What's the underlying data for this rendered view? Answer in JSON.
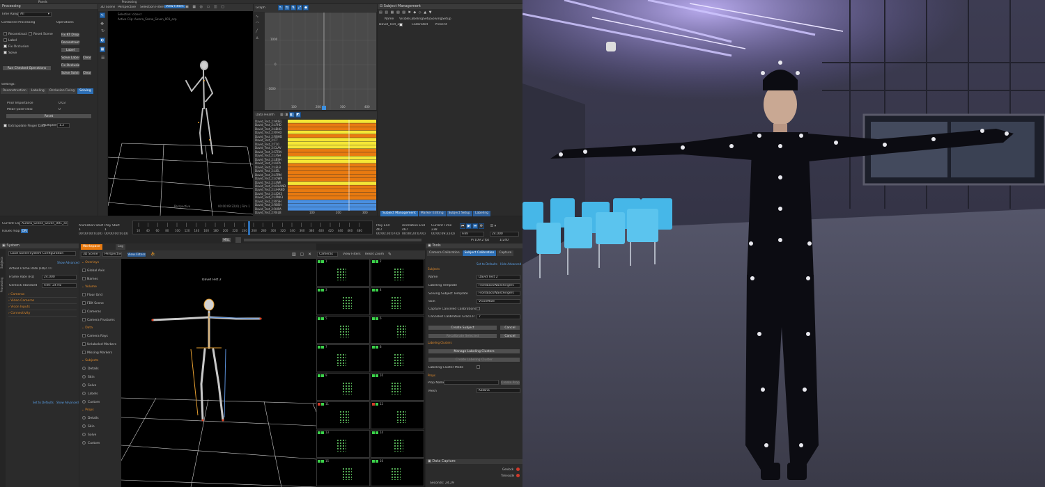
{
  "top_bar": {
    "panels": "Panels",
    "processing": "Processing"
  },
  "processing_panel": {
    "title": "Processing",
    "time_range_label": "Time Range:",
    "time_range_value": "All",
    "combined_processing": "Combined Processing",
    "operations": "Operations",
    "checks": [
      {
        "label": "Reconstruct",
        "on": false
      },
      {
        "label": "Reset Scene",
        "on": false
      },
      {
        "label": "Label",
        "on": false
      },
      {
        "label": "Fix Occlusion",
        "on": true
      },
      {
        "label": "Solve",
        "on": true
      }
    ],
    "op_buttons": [
      "Fix KT Drops",
      "Reconstruct",
      "Label",
      "Solve Labeling",
      "Clear",
      "Fix Occlusion",
      "Solve Solving",
      "Clear"
    ],
    "run_button": "Run Checked Operations",
    "settings_label": "Settings:",
    "settings_tabs": [
      "Reconstruction",
      "Labeling",
      "Occlusion Fixing",
      "Solving"
    ],
    "prior_importance_label": "Prior Importance",
    "prior_importance_value": "0.03",
    "mean_pose_label": "Mean-pose-ratio",
    "mean_pose_value": "0",
    "reset_button": "Reset",
    "extrapolate_label": "Extrapolate Finger Data",
    "multiplier_label": "Multiplier:",
    "multiplier_value": "1.2"
  },
  "scene_top": {
    "menu": [
      "3D Scene",
      "Perspective",
      "Selection Filters",
      "View Filters"
    ],
    "selection": "Selection: clone:r",
    "active_clip": "Active Clip: Aurora_Scene_Seven_001_ecp",
    "perspective": "Perspective",
    "timecode": "00:00:09:22(0) | Film 1"
  },
  "graph": {
    "title": "Graph",
    "y_ticks": [
      "1000",
      "0",
      "-1000"
    ],
    "x_ticks": [
      "100",
      "200",
      "300",
      "400"
    ]
  },
  "data_health": {
    "title": "Data Health",
    "rows": [
      "David_Test_2:ARIEL",
      "David_Test_2:LFHD",
      "David_Test_2:LBHD",
      "David_Test_2:RFHD",
      "David_Test_2:RBHD",
      "David_Test_2:C7",
      "David_Test_2:T10",
      "David_Test_2:CLAV",
      "David_Test_2:STRN",
      "David_Test_2:LFSH",
      "David_Test_2:LBSH",
      "David_Test_2:LUPA",
      "David_Test_2:LELB",
      "David_Test_2:LIEL",
      "David_Test_2:LFRM",
      "David_Test_2:LOWR",
      "David_Test_2:LIWR",
      "David_Test_2:LOHAND",
      "David_Test_2:LIHAND",
      "David_Test_2:LIDX3",
      "David_Test_2:LPNK3",
      "David_Test_2:RFSH",
      "David_Test_2:RBSH",
      "David_Test_2:RUPA",
      "David_Test_2:RELB"
    ],
    "x_ticks": [
      "100",
      "200",
      "300"
    ]
  },
  "subject_management": {
    "title": "Subject Management",
    "columns": [
      "Name",
      "Visible",
      "LabelingSetup",
      "SolvingSetup"
    ],
    "row": {
      "name": "David_Test_2",
      "labeling": "Calibrated",
      "solving": "Present"
    },
    "bottom_tabs": [
      "Subject Management",
      "Marker Editing",
      "Subject Setup",
      "Labeling"
    ]
  },
  "timeline": {
    "current_clip_label": "Current Clip:",
    "current_clip_value": "Aurora_Scene_Seven_001_ecp",
    "issues_map_label": "Issues map:",
    "issues_map_value": "ON",
    "anim_start_label": "Animation Start",
    "anim_start_value": "1",
    "anim_start_tc": "00:00:00:01(0)",
    "play_start_label": "Play Start",
    "play_start_value": "1",
    "play_start_tc": "00:00:00:01(0)",
    "ticks": [
      "10",
      "40",
      "60",
      "80",
      "100",
      "120",
      "140",
      "160",
      "180",
      "200",
      "220",
      "240",
      "260",
      "280",
      "300",
      "320",
      "340",
      "360",
      "380",
      "400",
      "420",
      "440",
      "460",
      "480"
    ],
    "play_end_label": "Play End",
    "play_end_value": "467",
    "play_end_tc": "00:00:20:07(0)",
    "anim_end_label": "Animation End",
    "anim_end_value": "467",
    "anim_end_tc": "00:00:20:07(0)",
    "current_time_label": "Current Time",
    "current_time_value": "238",
    "current_time_tc": "00:00:09:22(0)",
    "fps_value": "24.000",
    "fps_display": "Pi 109.2 fps",
    "frame_display": "1/240",
    "film_value": "Film",
    "msl_button": "MSL"
  },
  "system_panel": {
    "title": "System",
    "side_tabs": [
      "Subjects",
      "Processing"
    ],
    "load_config": "Load Saved System Configuration",
    "show_advanced": "Show Advanced",
    "actual_frame_rate_label": "Actual Frame Rate (Hz)",
    "actual_frame_rate_value": "24.00",
    "frame_rate_label": "Frame Rate (Hz)",
    "frame_rate_value": "24.000",
    "genlock_label": "Genlock Standard",
    "genlock_value": "Film: 24 Hz",
    "sections": [
      "Cameras",
      "Video Cameras",
      "Vicon Inputs",
      "Connectivity"
    ],
    "set_defaults": "Set to Defaults",
    "show_advanced_2": "Show Advanced"
  },
  "workspace": {
    "tabs": [
      "Workspace",
      "Log"
    ],
    "toolbar": [
      "3D Scene",
      "Perspective",
      "View Filters"
    ],
    "subject_label": "David Test 2",
    "filters": [
      {
        "type": "section",
        "label": "Overlays"
      },
      {
        "type": "check",
        "label": "Global Axis"
      },
      {
        "type": "check",
        "label": "Names"
      },
      {
        "type": "section",
        "label": "Volume"
      },
      {
        "type": "check",
        "label": "Floor Grid"
      },
      {
        "type": "check",
        "label": "FBX Scene"
      },
      {
        "type": "check",
        "label": "Cameras"
      },
      {
        "type": "check",
        "label": "Camera Frustums"
      },
      {
        "type": "section",
        "label": "Data"
      },
      {
        "type": "check",
        "label": "Camera Rays"
      },
      {
        "type": "check",
        "label": "Unlabeled Markers"
      },
      {
        "type": "check",
        "label": "Missing Markers"
      },
      {
        "type": "section",
        "label": "Subjects"
      },
      {
        "type": "radio",
        "label": "Details"
      },
      {
        "type": "radio",
        "label": "Skin"
      },
      {
        "type": "radio",
        "label": "Solve"
      },
      {
        "type": "radio",
        "label": "Labels"
      },
      {
        "type": "radio",
        "label": "Custom"
      },
      {
        "type": "section",
        "label": "Props"
      },
      {
        "type": "radio",
        "label": "Details"
      },
      {
        "type": "radio",
        "label": "Skin"
      },
      {
        "type": "radio",
        "label": "Solve"
      },
      {
        "type": "radio",
        "label": "Custom"
      }
    ]
  },
  "cameras_panel": {
    "menu": [
      "Cameras",
      "View Filters",
      "Reset Zoom"
    ],
    "numbers": [
      "1",
      "2",
      "3",
      "4",
      "5",
      "6",
      "7",
      "8",
      "9",
      "10",
      "11",
      "12",
      "13",
      "14",
      "15",
      "16"
    ]
  },
  "tools": {
    "title": "Tools",
    "tabs": [
      "Camera Calibration",
      "Subject Calibration",
      "Capture"
    ],
    "set_defaults": "Set to Defaults",
    "hide_advanced": "Hide Advanced",
    "subjects_section": "Subjects",
    "name_label": "Name",
    "name_value": "David Test 2",
    "labeling_template_label": "Labeling Template",
    "labeling_template_value": "FrontBackWaistFingers",
    "solving_template_label": "Solving Subject Template",
    "solving_template_value": "FrontBackWaistFingers",
    "skin_label": "Skin",
    "skin_value": "ViconMale",
    "capture_cancel_label": "Capture Canceled Calibrations",
    "grace_label": "Canceled Calibration Grace Perio...",
    "grace_value": "7",
    "create_subject": "Create Subject",
    "cancel": "Cancel",
    "recalibrate": "Recalibrate Selected",
    "cancel2": "Cancel",
    "labeling_clusters_section": "Labeling Clusters",
    "manage_clusters": "Manage Labeling Clusters",
    "create_cluster": "Create Labeling Cluster",
    "cluster_mode_label": "Labeling Cluster Mode",
    "props_section": "Props",
    "prop_name_label": "Prop Name",
    "create_prop": "Create Prop",
    "mesh_label": "Mesh",
    "mesh_value": "Katana",
    "data_capture": "Data Capture",
    "genlock": "Genlock",
    "timecode": "Timecode",
    "seconds_label": "Seconds: 24.29"
  },
  "colors": {
    "accent": "#2d6fb5",
    "orange": "#e87a10",
    "yellow": "#f5e636",
    "health_blue": "#4a8fe0",
    "ok_green": "#3bd14a",
    "error_red": "#d23a2a"
  }
}
